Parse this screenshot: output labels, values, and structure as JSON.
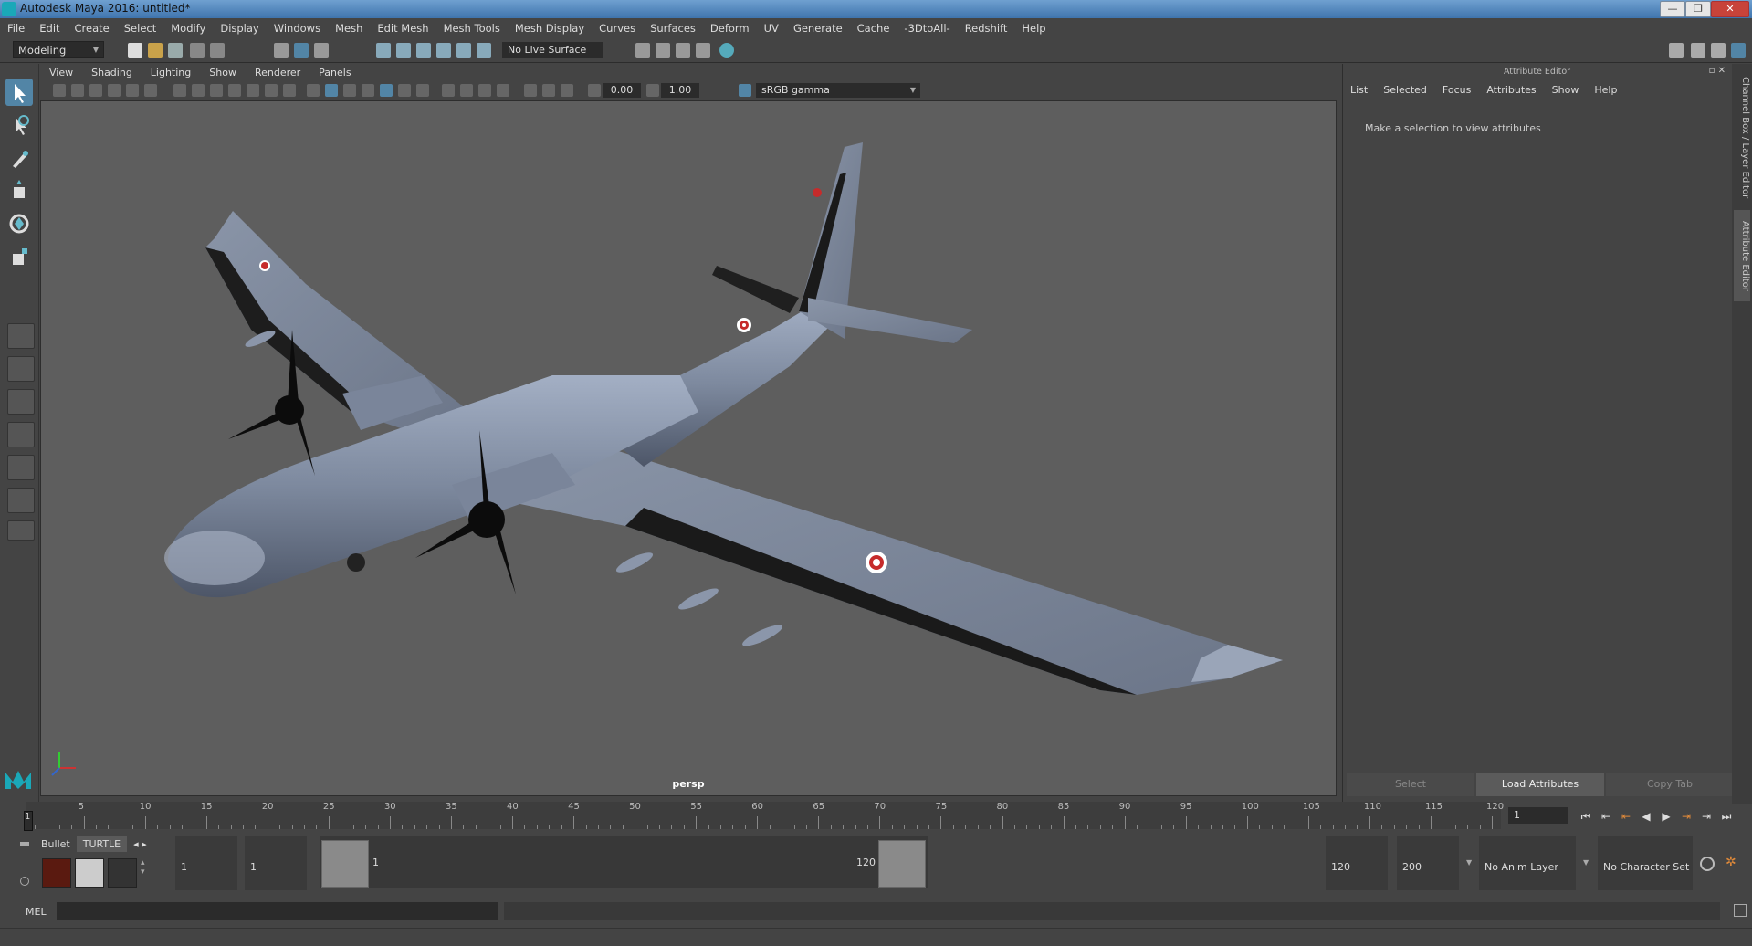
{
  "window": {
    "title": "Autodesk Maya 2016: untitled*",
    "minimize": "—",
    "maximize": "❐",
    "close": "✕"
  },
  "menubar": [
    "File",
    "Edit",
    "Create",
    "Select",
    "Modify",
    "Display",
    "Windows",
    "Mesh",
    "Edit Mesh",
    "Mesh Tools",
    "Mesh Display",
    "Curves",
    "Surfaces",
    "Deform",
    "UV",
    "Generate",
    "Cache",
    "-3DtoAll-",
    "Redshift",
    "Help"
  ],
  "statusline": {
    "mode": "Modeling",
    "live_surface": "No Live Surface"
  },
  "viewport": {
    "menu": [
      "View",
      "Shading",
      "Lighting",
      "Show",
      "Renderer",
      "Panels"
    ],
    "exposure": "0.00",
    "gamma": "1.00",
    "color_space": "sRGB gamma",
    "camera": "persp"
  },
  "attribute_editor": {
    "title": "Attribute Editor",
    "menu": [
      "List",
      "Selected",
      "Focus",
      "Attributes",
      "Show",
      "Help"
    ],
    "message": "Make a selection to view attributes",
    "buttons": {
      "select": "Select",
      "load": "Load Attributes",
      "copy": "Copy Tab"
    }
  },
  "side_tabs": {
    "channel_box": "Channel Box / Layer Editor",
    "attribute_editor": "Attribute Editor"
  },
  "timeline": {
    "ticks": [
      "5",
      "10",
      "15",
      "20",
      "25",
      "30",
      "35",
      "40",
      "45",
      "50",
      "55",
      "60",
      "65",
      "70",
      "75",
      "80",
      "85",
      "90",
      "95",
      "100",
      "105",
      "110",
      "115",
      "120"
    ],
    "current": "1",
    "frame_field": "1"
  },
  "range": {
    "shelf_tabs": [
      "Bullet",
      "TURTLE"
    ],
    "start": "1",
    "start2": "1",
    "range_start": "1",
    "range_end": "120",
    "end": "120",
    "end2": "200",
    "anim_layer": "No Anim Layer",
    "char_set": "No Character Set"
  },
  "cmdline": {
    "label": "MEL"
  }
}
